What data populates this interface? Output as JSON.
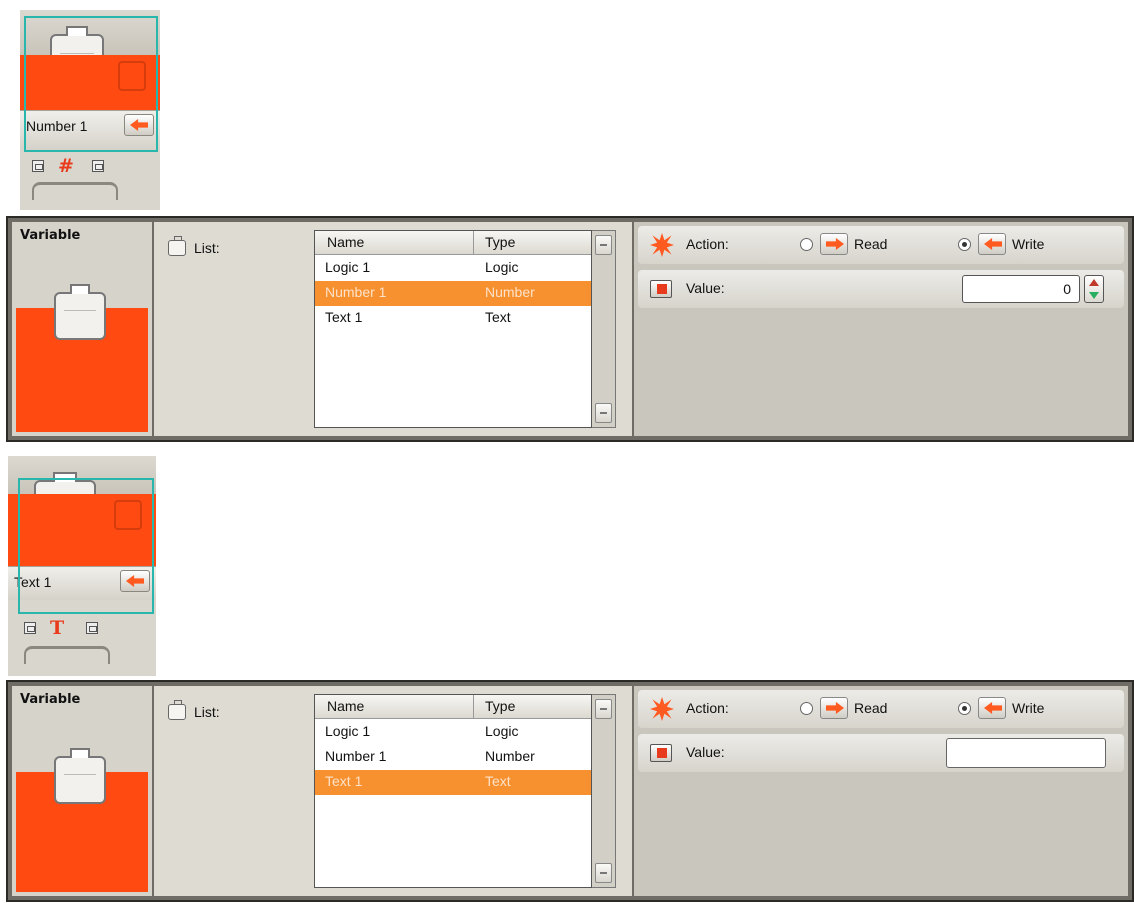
{
  "block1": {
    "label": "Number 1",
    "type_symbol": "#"
  },
  "block2": {
    "label": "Text 1",
    "type_symbol": "T"
  },
  "panel1": {
    "title": "Variable",
    "list_label": "List:",
    "columns": [
      "Name",
      "Type"
    ],
    "rows": [
      {
        "name": "Logic 1",
        "type": "Logic"
      },
      {
        "name": "Number 1",
        "type": "Number"
      },
      {
        "name": "Text 1",
        "type": "Text"
      }
    ],
    "selected_row": "Number 1",
    "action_label": "Action:",
    "read_label": "Read",
    "write_label": "Write",
    "selected_action": "Write",
    "value_label": "Value:",
    "value": "0"
  },
  "panel2": {
    "title": "Variable",
    "list_label": "List:",
    "columns": [
      "Name",
      "Type"
    ],
    "rows": [
      {
        "name": "Logic 1",
        "type": "Logic"
      },
      {
        "name": "Number 1",
        "type": "Number"
      },
      {
        "name": "Text 1",
        "type": "Text"
      }
    ],
    "selected_row": "Text 1",
    "action_label": "Action:",
    "read_label": "Read",
    "write_label": "Write",
    "selected_action": "Write",
    "value_label": "Value:",
    "value": ""
  },
  "colors": {
    "accent_orange": "#ff4a12",
    "selection": "#f7902e",
    "frame_teal": "#29b6ad"
  },
  "icons": [
    "briefcase-icon",
    "plug-arrow-icon",
    "hash-icon",
    "text-t-icon",
    "burst-icon",
    "value-plug-icon",
    "read-arrow-icon",
    "write-arrow-icon",
    "spinner-icon"
  ]
}
